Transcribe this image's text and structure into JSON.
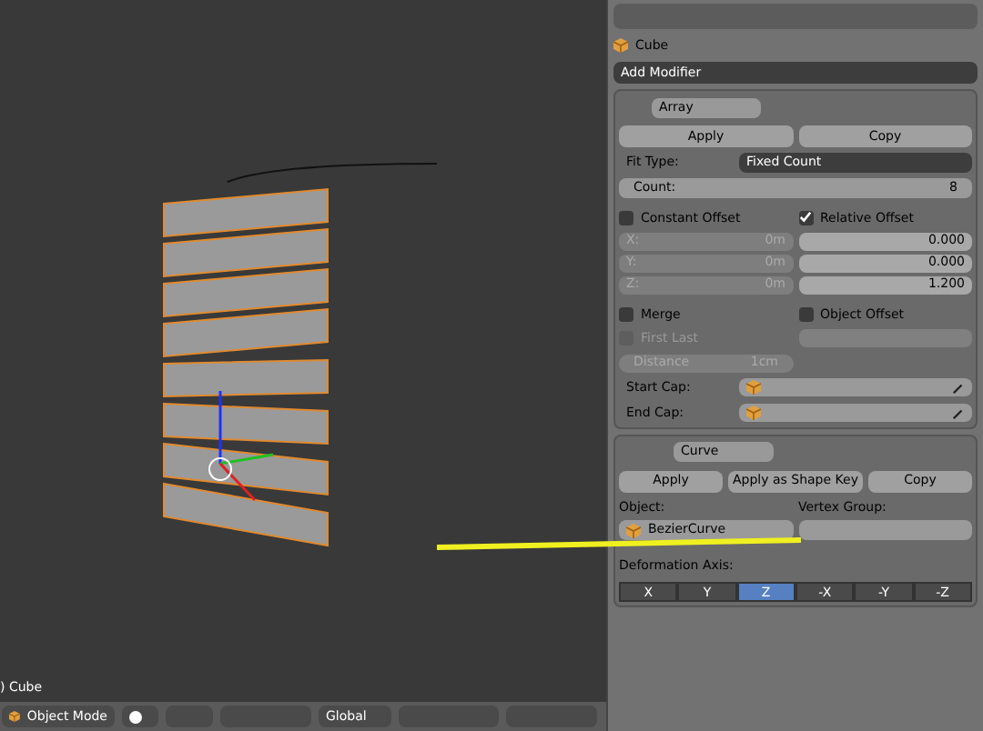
{
  "viewport": {
    "object_label": ") Cube"
  },
  "header": {
    "mode": "Object Mode",
    "orientation": "Global"
  },
  "properties": {
    "breadcrumb": "Cube",
    "add_modifier": "Add Modifier",
    "array": {
      "name": "Array",
      "apply": "Apply",
      "copy": "Copy",
      "fit_type_label": "Fit Type:",
      "fit_type": "Fixed Count",
      "count_label": "Count:",
      "count": "8",
      "constant_offset": {
        "label": "Constant Offset",
        "checked": false
      },
      "relative_offset": {
        "label": "Relative Offset",
        "checked": true
      },
      "constant_fields": [
        {
          "label": "X:",
          "value": "0m",
          "disabled": true
        },
        {
          "label": "Y:",
          "value": "0m",
          "disabled": true
        },
        {
          "label": "Z:",
          "value": "0m",
          "disabled": true
        }
      ],
      "relative_fields": [
        {
          "value": "0.000"
        },
        {
          "value": "0.000"
        },
        {
          "value": "1.200"
        }
      ],
      "merge": {
        "label": "Merge",
        "checked": false
      },
      "object_offset": {
        "label": "Object Offset",
        "checked": false
      },
      "first_last": {
        "label": "First Last",
        "checked": false,
        "disabled": true
      },
      "distance": {
        "label": "Distance",
        "value": "1cm",
        "disabled": true
      },
      "start_cap_label": "Start Cap:",
      "end_cap_label": "End Cap:"
    },
    "curve": {
      "name": "Curve",
      "buttons": [
        "Apply",
        "Apply as Shape Key",
        "Copy"
      ],
      "object_label": "Object:",
      "object": "BezierCurve",
      "vertex_group_label": "Vertex Group:",
      "axis_label": "Deformation Axis:",
      "axes": [
        {
          "label": "X",
          "selected": false
        },
        {
          "label": "Y",
          "selected": false
        },
        {
          "label": "Z",
          "selected": true
        },
        {
          "label": "-X",
          "selected": false
        },
        {
          "label": "-Y",
          "selected": false
        },
        {
          "label": "-Z",
          "selected": false
        }
      ]
    }
  }
}
